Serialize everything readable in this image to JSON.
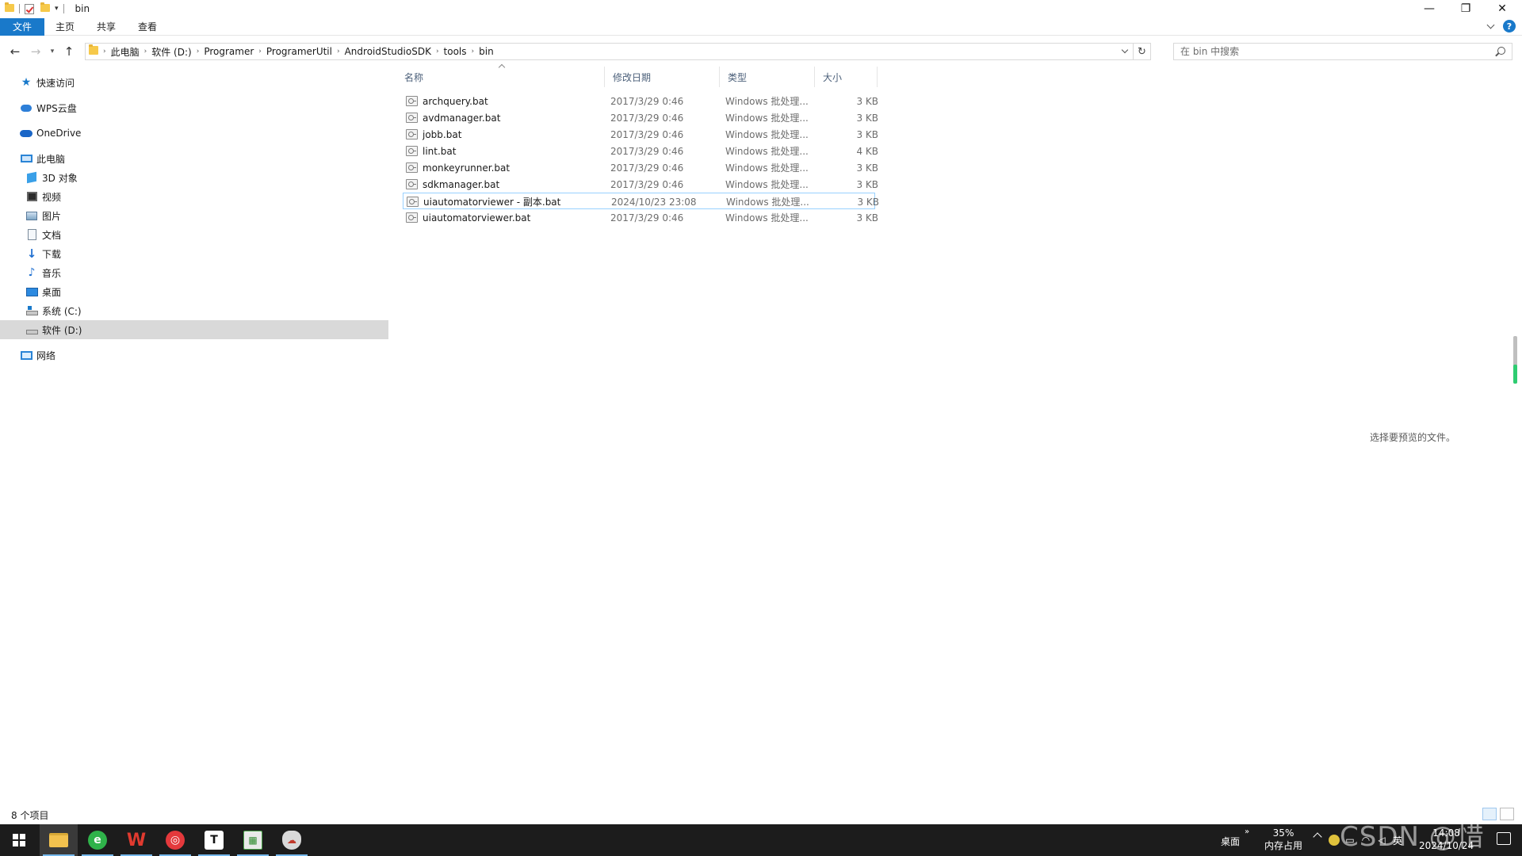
{
  "window": {
    "title": "bin",
    "controls": {
      "minimize": "—",
      "restore": "❐",
      "close": "✕"
    }
  },
  "ribbon": {
    "tabs": [
      "文件",
      "主页",
      "共享",
      "查看"
    ],
    "help_label": "?"
  },
  "address": {
    "breadcrumbs": [
      "此电脑",
      "软件 (D:)",
      "Programer",
      "ProgramerUtil",
      "AndroidStudioSDK",
      "tools",
      "bin"
    ]
  },
  "search": {
    "placeholder": "在 bin 中搜索"
  },
  "navpane": {
    "items": [
      {
        "label": "快速访问",
        "icon": "star-icon"
      },
      {
        "label": "WPS云盘",
        "icon": "cloud-icon"
      },
      {
        "label": "OneDrive",
        "icon": "onedrive-icon"
      },
      {
        "label": "此电脑",
        "icon": "pc-icon"
      },
      {
        "label": "3D 对象",
        "icon": "3d-objects-icon"
      },
      {
        "label": "视频",
        "icon": "video-icon"
      },
      {
        "label": "图片",
        "icon": "picture-icon"
      },
      {
        "label": "文档",
        "icon": "document-icon"
      },
      {
        "label": "下载",
        "icon": "download-icon"
      },
      {
        "label": "音乐",
        "icon": "music-icon"
      },
      {
        "label": "桌面",
        "icon": "desktop-icon"
      },
      {
        "label": "系统 (C:)",
        "icon": "drive-c-icon"
      },
      {
        "label": "软件 (D:)",
        "icon": "drive-d-icon",
        "selected": true
      },
      {
        "label": "网络",
        "icon": "network-icon"
      }
    ]
  },
  "filelist": {
    "columns": [
      "名称",
      "修改日期",
      "类型",
      "大小"
    ],
    "rows": [
      {
        "name": "archquery.bat",
        "date": "2017/3/29 0:46",
        "type": "Windows 批处理...",
        "size": "3 KB"
      },
      {
        "name": "avdmanager.bat",
        "date": "2017/3/29 0:46",
        "type": "Windows 批处理...",
        "size": "3 KB"
      },
      {
        "name": "jobb.bat",
        "date": "2017/3/29 0:46",
        "type": "Windows 批处理...",
        "size": "3 KB"
      },
      {
        "name": "lint.bat",
        "date": "2017/3/29 0:46",
        "type": "Windows 批处理...",
        "size": "4 KB"
      },
      {
        "name": "monkeyrunner.bat",
        "date": "2017/3/29 0:46",
        "type": "Windows 批处理...",
        "size": "3 KB"
      },
      {
        "name": "sdkmanager.bat",
        "date": "2017/3/29 0:46",
        "type": "Windows 批处理...",
        "size": "3 KB"
      },
      {
        "name": "uiautomatorviewer - 副本.bat",
        "date": "2024/10/23 23:08",
        "type": "Windows 批处理...",
        "size": "3 KB",
        "selected": true
      },
      {
        "name": "uiautomatorviewer.bat",
        "date": "2017/3/29 0:46",
        "type": "Windows 批处理...",
        "size": "3 KB"
      }
    ]
  },
  "preview": {
    "message": "选择要预览的文件。"
  },
  "status": {
    "item_count": "8 个项目"
  },
  "taskbar": {
    "apps": [
      "windows-start",
      "file-explorer",
      "browser",
      "wps",
      "netease-music",
      "typora",
      "spreadsheet",
      "cloud-app"
    ],
    "desktop_label": "桌面",
    "expand_label": "»",
    "memory_percent": "35%",
    "memory_label": "内存占用",
    "ime_label": "英",
    "time": "14:08",
    "date": "2024/10/24"
  },
  "watermark": "CSDN @惜"
}
